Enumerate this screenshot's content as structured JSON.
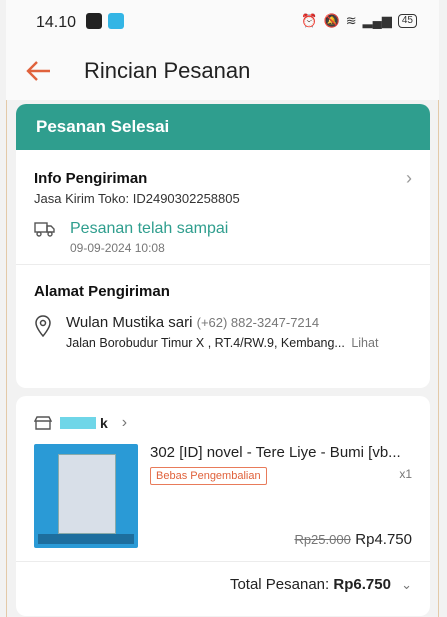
{
  "status_bar": {
    "time": "14.10",
    "battery": "45"
  },
  "header": {
    "title": "Rincian Pesanan"
  },
  "order_status": {
    "label": "Pesanan Selesai"
  },
  "shipping_info": {
    "title": "Info Pengiriman",
    "courier": "Jasa Kirim Toko: ID2490302258805",
    "delivery_status": "Pesanan telah sampai",
    "delivery_time": "09-09-2024 10:08"
  },
  "address": {
    "title": "Alamat Pengiriman",
    "name": "Wulan Mustika sari",
    "phone": "(+62) 882-3247-7214",
    "street": "Jalan Borobudur Timur X , RT.4/RW.9, Kembang...",
    "view_label": "Lihat"
  },
  "shop": {
    "name": "k",
    "product": {
      "title": "302 [ID] novel - Tere Liye - Bumi [vb...",
      "badge": "Bebas Pengembalian",
      "quantity": "x1",
      "original_price": "Rp25.000",
      "price": "Rp4.750"
    },
    "total_label": "Total Pesanan:",
    "total_value": "Rp6.750"
  },
  "colors": {
    "accent": "#2f9e8e",
    "back_arrow": "#e0623c"
  }
}
